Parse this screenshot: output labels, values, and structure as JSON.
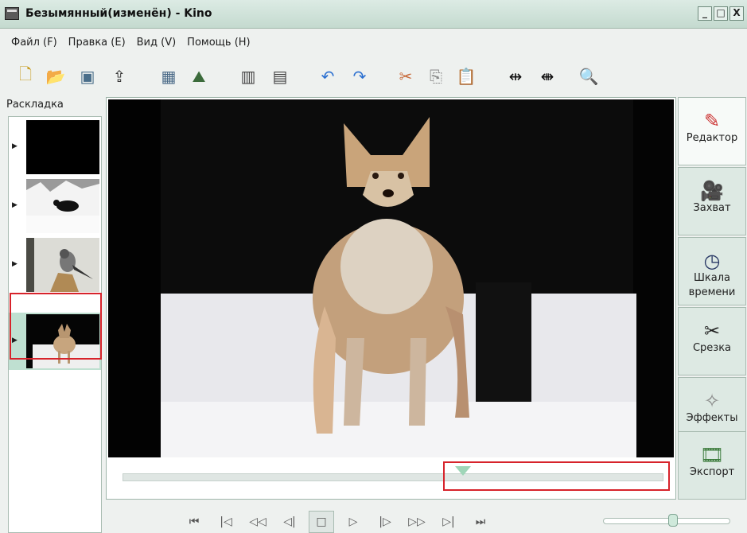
{
  "window": {
    "title": "Безымянный(изменён) - Kino",
    "buttons": [
      "_",
      "□",
      "X"
    ]
  },
  "menu": [
    {
      "label": "Файл (F)"
    },
    {
      "label": "Правка (E)"
    },
    {
      "label": "Вид (V)"
    },
    {
      "label": "Помощь (H)"
    }
  ],
  "toolbar": [
    {
      "icon": "new-file-icon",
      "glyph": "🗋"
    },
    {
      "icon": "open-folder-icon",
      "glyph": "📂"
    },
    {
      "icon": "save-icon",
      "glyph": "▣"
    },
    {
      "icon": "export-still-icon",
      "glyph": "⇪"
    },
    {
      "icon": "save-frame-icon",
      "glyph": "▦"
    },
    {
      "icon": "publish-icon",
      "glyph": "⛰"
    },
    {
      "icon": "insert-before-icon",
      "glyph": "▥"
    },
    {
      "icon": "insert-after-icon",
      "glyph": "▤"
    },
    {
      "icon": "undo-icon",
      "glyph": "↶"
    },
    {
      "icon": "redo-icon",
      "glyph": "↷"
    },
    {
      "icon": "cut-icon",
      "glyph": "✂"
    },
    {
      "icon": "copy-icon",
      "glyph": "⎘"
    },
    {
      "icon": "paste-icon",
      "glyph": "📋"
    },
    {
      "icon": "split-scene-icon",
      "glyph": "⇹"
    },
    {
      "icon": "join-scenes-icon",
      "glyph": "⇼"
    },
    {
      "icon": "zoom-icon",
      "glyph": "🔍"
    }
  ],
  "sidebar": {
    "label": "Раскладка"
  },
  "storyboard": {
    "clips": [
      {
        "name": "black-clip"
      },
      {
        "name": "snow-animal-clip"
      },
      {
        "name": "bird-clip"
      },
      {
        "name": "coyote-clip",
        "selected": true
      }
    ]
  },
  "scrubber": {
    "position_fraction": 0.63
  },
  "side_tabs": [
    {
      "label": "Редактор",
      "icon": "editor-icon",
      "glyph": "✎",
      "active": true
    },
    {
      "label": "Захват",
      "icon": "capture-icon",
      "glyph": "🎥"
    },
    {
      "label": "Шкала времени",
      "icon": "timeline-clock-icon",
      "glyph": "◷"
    },
    {
      "label": "Срезка",
      "icon": "trim-icon",
      "glyph": "✂"
    },
    {
      "label": "Эффекты",
      "icon": "effects-icon",
      "glyph": "✧"
    },
    {
      "label": "Экспорт",
      "icon": "export-reel-icon",
      "glyph": "🎞"
    }
  ],
  "transport": [
    {
      "icon": "first-frame-icon",
      "glyph": "⏮"
    },
    {
      "icon": "prev-scene-icon",
      "glyph": "|◁"
    },
    {
      "icon": "rewind-icon",
      "glyph": "◁◁"
    },
    {
      "icon": "prev-frame-icon",
      "glyph": "◁|"
    },
    {
      "icon": "stop-icon",
      "glyph": "□"
    },
    {
      "icon": "play-icon",
      "glyph": "▷"
    },
    {
      "icon": "next-frame-icon",
      "glyph": "|▷"
    },
    {
      "icon": "fast-forward-icon",
      "glyph": "▷▷"
    },
    {
      "icon": "next-scene-icon",
      "glyph": "▷|"
    },
    {
      "icon": "last-frame-icon",
      "glyph": "⏭"
    }
  ],
  "volume": {
    "level_fraction": 0.55
  }
}
